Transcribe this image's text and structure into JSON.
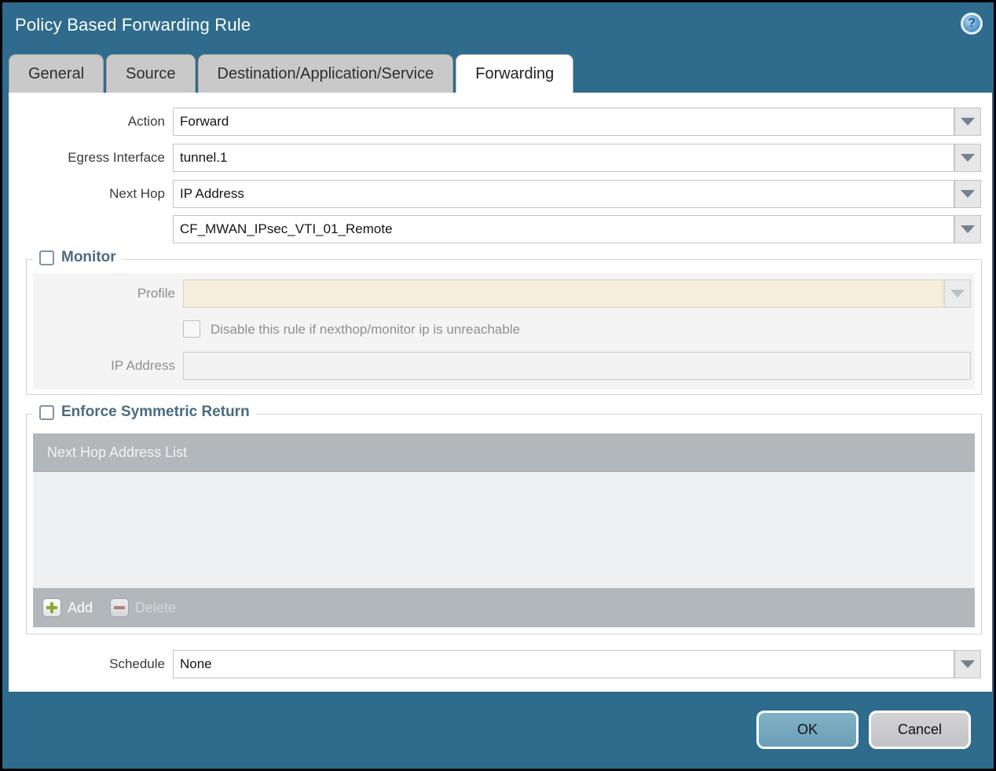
{
  "dialog": {
    "title": "Policy Based Forwarding Rule",
    "help_glyph": "?"
  },
  "tabs": [
    {
      "label": "General",
      "active": false
    },
    {
      "label": "Source",
      "active": false
    },
    {
      "label": "Destination/Application/Service",
      "active": false
    },
    {
      "label": "Forwarding",
      "active": true
    }
  ],
  "form": {
    "action": {
      "label": "Action",
      "value": "Forward"
    },
    "egress_interface": {
      "label": "Egress Interface",
      "value": "tunnel.1"
    },
    "next_hop": {
      "label": "Next Hop",
      "value": "IP Address"
    },
    "next_hop_address": {
      "value": "CF_MWAN_IPsec_VTI_01_Remote"
    },
    "monitor": {
      "legend": "Monitor",
      "checked": false,
      "profile": {
        "label": "Profile",
        "value": ""
      },
      "disable_rule": {
        "label": "Disable this rule if nexthop/monitor ip is unreachable",
        "checked": false
      },
      "ip_address": {
        "label": "IP Address",
        "value": ""
      }
    },
    "enforce_symmetric_return": {
      "legend": "Enforce Symmetric Return",
      "checked": false,
      "table": {
        "header": "Next Hop Address List",
        "rows": []
      },
      "add_label": "Add",
      "delete_label": "Delete",
      "delete_enabled": false
    },
    "schedule": {
      "label": "Schedule",
      "value": "None"
    }
  },
  "footer": {
    "ok_label": "OK",
    "cancel_label": "Cancel"
  },
  "colors": {
    "chrome_teal": "#2e6b8c",
    "active_tab_bg": "#ffffff",
    "inactive_tab_bg": "#c9c9c9",
    "legend_text": "#496c80",
    "disabled_profile_bg": "#f5eedb",
    "table_header_bg": "#b2b7bb",
    "add_plus_green": "#8aa82e",
    "delete_minus_red": "#b2705e",
    "ok_button_bg": "#6fa6bd",
    "cancel_button_bg": "#c9c9cd"
  }
}
